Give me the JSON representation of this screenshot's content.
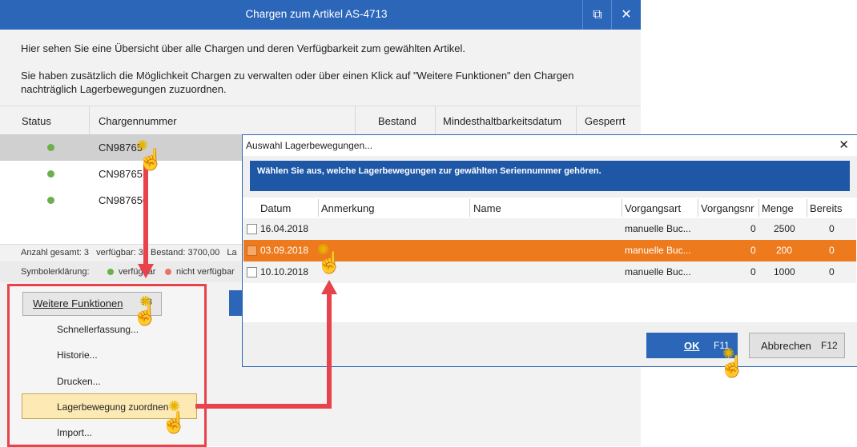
{
  "main": {
    "title": "Chargen zum Artikel AS-4713",
    "info_1": "Hier sehen Sie eine Übersicht über alle Chargen und deren Verfügbarkeit zum gewählten Artikel.",
    "info_2": "Sie haben zusätzlich die Möglichkeit Chargen zu verwalten oder über einen Klick auf \"Weitere Funktionen\" den Chargen",
    "info_3": "nachträglich Lagerbewegungen zuzuordnen.",
    "columns": [
      "Status",
      "Chargennummer",
      "Bestand",
      "Mindesthaltbarkeitsdatum",
      "Gesperrt"
    ],
    "rows": [
      {
        "charge": "CN98765"
      },
      {
        "charge": "CN98765"
      },
      {
        "charge": "CN987656"
      }
    ],
    "status_bar": "Anzahl gesamt: 3   verfügbar: 3   Bestand: 3700,00   La",
    "legend_label": "Symbolerklärung:",
    "legend_available": "verfügbar",
    "legend_unavailable": "nicht verfügbar",
    "colors": {
      "title": "#2b66b9",
      "available": "#6ab04c",
      "unavailable": "#e8746a",
      "accent": "#e8424b"
    }
  },
  "menu": {
    "button_label": "Weitere Funktionen",
    "button_key": "F3",
    "items": [
      "Schnellerfassung...",
      "Historie...",
      "Drucken...",
      "Lagerbewegung zuordnen",
      "Import..."
    ]
  },
  "dialog": {
    "title": "Auswahl Lagerbewegungen...",
    "banner": "Wählen Sie aus, welche Lagerbewegungen zur gewählten Seriennummer gehören.",
    "columns": [
      "Datum",
      "Anmerkung",
      "Name",
      "Vorgangsart",
      "Vorgangsnr",
      "Menge",
      "Bereits"
    ],
    "rows": [
      {
        "datum": "16.04.2018",
        "vorgangsart": "manuelle Buc...",
        "vorgangsnr": "0",
        "menge": "2500",
        "bereits": "0"
      },
      {
        "datum": "03.09.2018",
        "vorgangsart": "manuelle Buc...",
        "vorgangsnr": "0",
        "menge": "200",
        "bereits": "0"
      },
      {
        "datum": "10.10.2018",
        "vorgangsart": "manuelle Buc...",
        "vorgangsnr": "0",
        "menge": "1000",
        "bereits": "0"
      }
    ],
    "ok_label": "OK",
    "ok_key": "F11",
    "cancel_label": "Abbrechen",
    "cancel_key": "F12",
    "selected_color": "#ee7a1e",
    "ok_color": "#2b66b9"
  }
}
